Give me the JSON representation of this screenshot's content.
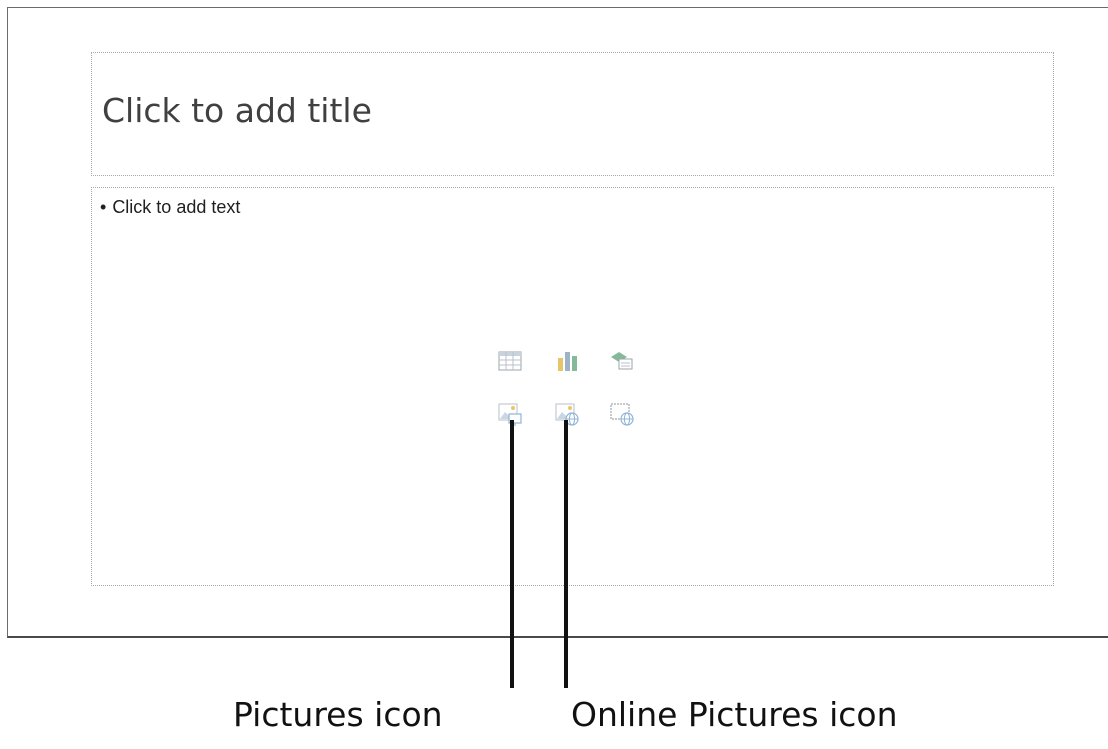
{
  "slide": {
    "title_placeholder": "Click to add title",
    "content_placeholder": "Click to add text",
    "bullet": "•",
    "content_icons": [
      {
        "name": "insert-table-icon",
        "label": ""
      },
      {
        "name": "insert-chart-icon",
        "label": ""
      },
      {
        "name": "insert-smartart-icon",
        "label": ""
      },
      {
        "name": "pictures-icon",
        "label": ""
      },
      {
        "name": "online-pictures-icon",
        "label": ""
      },
      {
        "name": "insert-video-icon",
        "label": ""
      }
    ]
  },
  "callouts": {
    "pictures": "Pictures icon",
    "online_pictures": "Online Pictures icon"
  },
  "colors": {
    "placeholder_border": "#a9a9a9",
    "title_text": "#404040",
    "icon_blue": "#8fb3d9",
    "icon_gold": "#e6c66a",
    "icon_green": "#86b99a",
    "leader_line": "#111111"
  }
}
